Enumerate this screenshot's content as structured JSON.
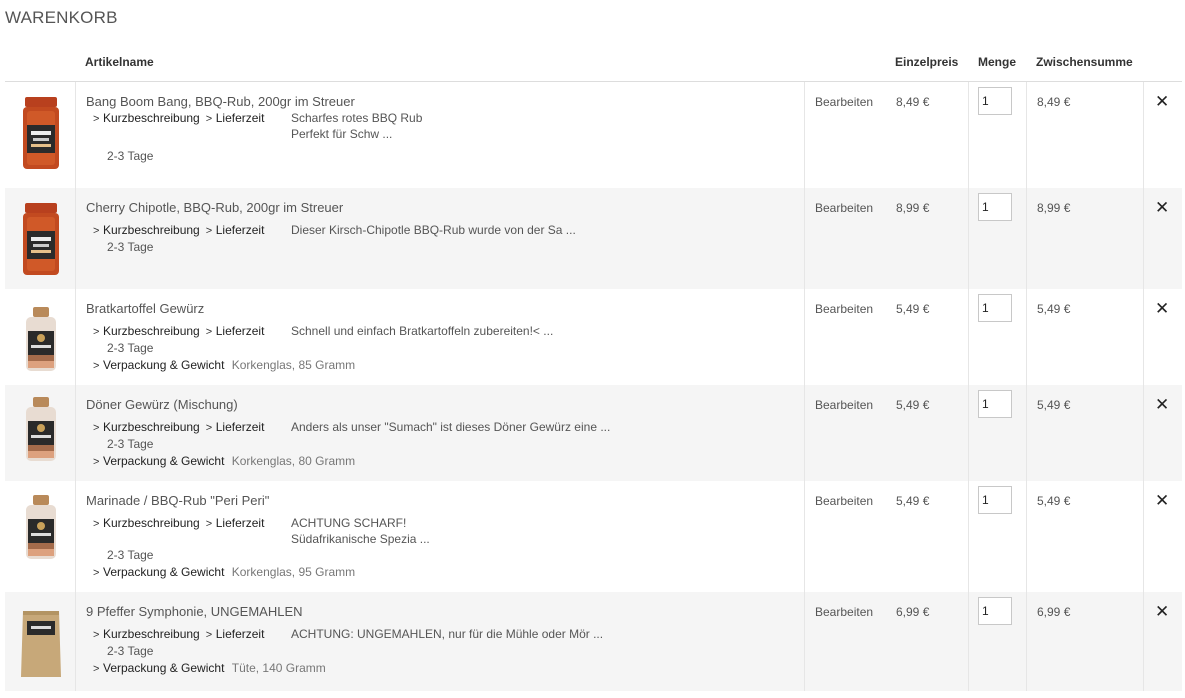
{
  "page_title": "WARENKORB",
  "columns": {
    "name": "Artikelname",
    "price": "Einzelpreis",
    "qty": "Menge",
    "subtotal": "Zwischensumme"
  },
  "labels": {
    "edit": "Bearbeiten",
    "short_desc": "Kurzbeschreibung",
    "delivery": "Lieferzeit",
    "packaging": "Verpackung & Gewicht",
    "delivery_time": "2-3 Tage",
    "remove": "✕"
  },
  "items": [
    {
      "name": "Bang Boom Bang, BBQ-Rub, 200gr im Streuer",
      "desc": "Scharfes rotes BBQ Rub",
      "desc2": "Perfekt für Schw ...",
      "packaging": "",
      "price": "8,49 €",
      "qty": "1",
      "subtotal": "8,49 €",
      "product_type": "shaker"
    },
    {
      "name": "Cherry Chipotle, BBQ-Rub, 200gr im Streuer",
      "desc": "Dieser Kirsch-Chipotle BBQ-Rub wurde von der Sa ...",
      "desc2": "",
      "packaging": "",
      "price": "8,99 €",
      "qty": "1",
      "subtotal": "8,99 €",
      "product_type": "shaker"
    },
    {
      "name": "Bratkartoffel Gewürz",
      "desc": "Schnell und einfach Bratkartoffeln zubereiten!< ...",
      "desc2": "",
      "packaging": "Korkenglas, 85 Gramm",
      "price": "5,49 €",
      "qty": "1",
      "subtotal": "5,49 €",
      "product_type": "jar"
    },
    {
      "name": "Döner Gewürz (Mischung)",
      "desc": "Anders als unser \"Sumach\" ist dieses Döner Gewürz eine ...",
      "desc2": "",
      "packaging": "Korkenglas, 80 Gramm",
      "price": "5,49 €",
      "qty": "1",
      "subtotal": "5,49 €",
      "product_type": "jar"
    },
    {
      "name": "Marinade / BBQ-Rub \"Peri Peri\"",
      "desc": "ACHTUNG SCHARF!",
      "desc2": "Südafrikanische Spezia ...",
      "packaging": "Korkenglas, 95 Gramm",
      "price": "5,49 €",
      "qty": "1",
      "subtotal": "5,49 €",
      "product_type": "jar"
    },
    {
      "name": "9 Pfeffer Symphonie, UNGEMAHLEN",
      "desc": "ACHTUNG: UNGEMAHLEN, nur für die Mühle oder Mör ...",
      "desc2": "",
      "packaging": "Tüte, 140 Gramm",
      "price": "6,99 €",
      "qty": "1",
      "subtotal": "6,99 €",
      "product_type": "pouch"
    }
  ],
  "colors": {
    "alt_row": "#f5f5f5",
    "border": "#dddddd",
    "label": "#222222",
    "muted": "#777777"
  }
}
